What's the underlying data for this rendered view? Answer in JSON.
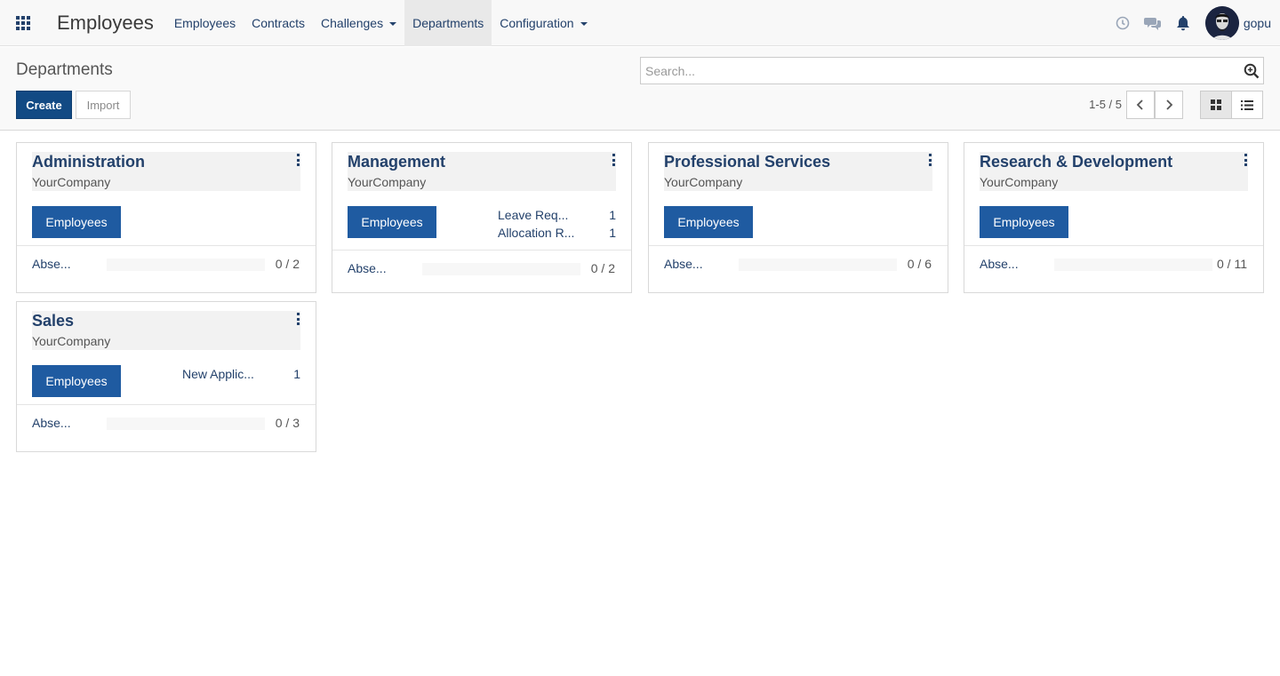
{
  "navbar": {
    "app_title": "Employees",
    "menu": [
      {
        "label": "Employees",
        "dropdown": false,
        "active": false
      },
      {
        "label": "Contracts",
        "dropdown": false,
        "active": false
      },
      {
        "label": "Challenges",
        "dropdown": true,
        "active": false
      },
      {
        "label": "Departments",
        "dropdown": false,
        "active": true
      },
      {
        "label": "Configuration",
        "dropdown": true,
        "active": false
      }
    ],
    "icons": [
      "clock-icon",
      "chat-icon",
      "bell-icon"
    ],
    "user_name": "gopu"
  },
  "control_panel": {
    "breadcrumb": "Departments",
    "create_label": "Create",
    "import_label": "Import",
    "search_placeholder": "Search...",
    "pager_value": "1-5 / 5",
    "active_view": "kanban"
  },
  "theme": {
    "primary": "#23416b",
    "button": "#1f5ba1",
    "create_button": "#124a84"
  },
  "departments": [
    {
      "name": "Administration",
      "company": "YourCompany",
      "employees_button": "Employees",
      "stats": [],
      "absence_label": "Abse...",
      "absence_fraction": 0,
      "absence_count": "0 / 2"
    },
    {
      "name": "Management",
      "company": "YourCompany",
      "employees_button": "Employees",
      "stats": [
        {
          "label": "Leave Req...",
          "value": "1"
        },
        {
          "label": "Allocation R...",
          "value": "1"
        }
      ],
      "absence_label": "Abse...",
      "absence_fraction": 0,
      "absence_count": "0 / 2"
    },
    {
      "name": "Professional Services",
      "company": "YourCompany",
      "employees_button": "Employees",
      "stats": [],
      "absence_label": "Abse...",
      "absence_fraction": 0,
      "absence_count": "0 / 6"
    },
    {
      "name": "Research & Development",
      "company": "YourCompany",
      "employees_button": "Employees",
      "stats": [],
      "absence_label": "Abse...",
      "absence_fraction": 0,
      "absence_count": "0 / 11"
    },
    {
      "name": "Sales",
      "company": "YourCompany",
      "employees_button": "Employees",
      "stats": [
        {
          "label": "New Applic...",
          "value": "1"
        }
      ],
      "absence_label": "Abse...",
      "absence_fraction": 0,
      "absence_count": "0 / 3"
    }
  ]
}
